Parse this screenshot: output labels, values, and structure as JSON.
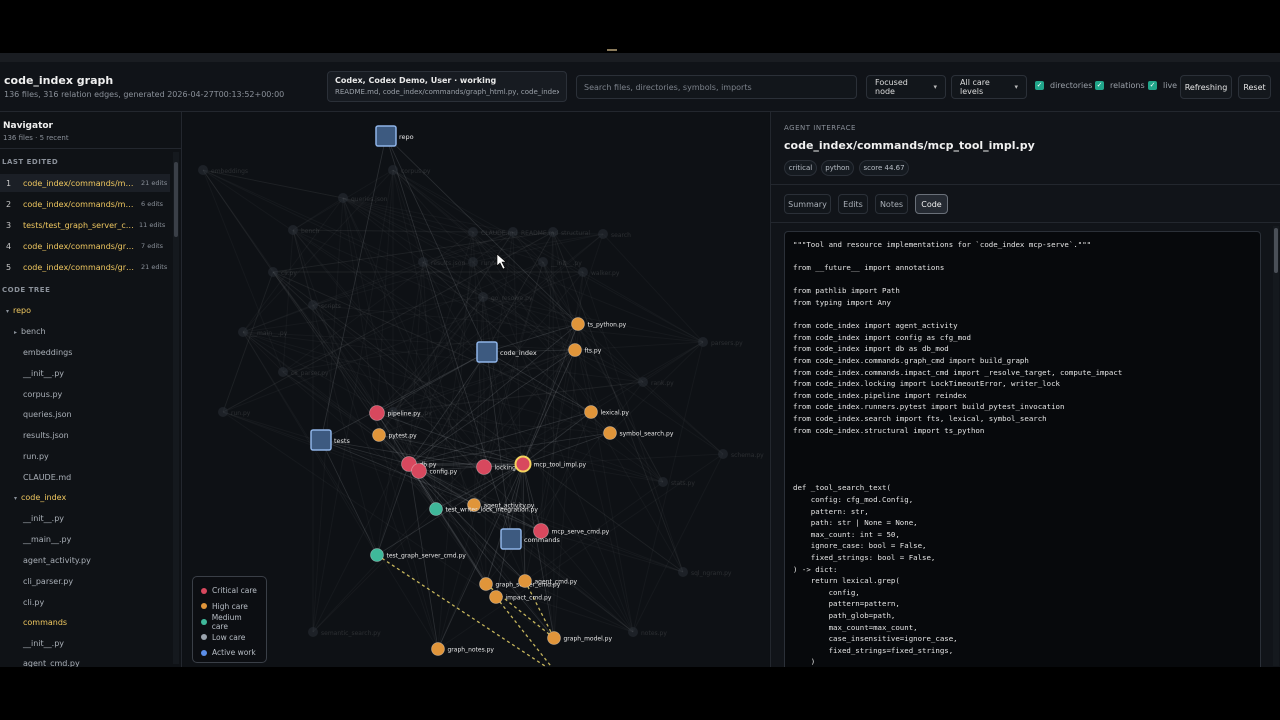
{
  "header": {
    "title": "code_index graph",
    "subtitle": "136 files, 316 relation edges, generated 2026-04-27T00:13:52+00:00",
    "activity_line1": "Codex, Codex Demo, User · working",
    "activity_line2": "README.md, code_index/commands/graph_html.py, code_index/co...",
    "search_placeholder": "Search files, directories, symbols, imports",
    "focus_select": "Focused node",
    "care_select": "All care levels",
    "checkboxes": [
      {
        "label": "directories"
      },
      {
        "label": "relations"
      },
      {
        "label": "live"
      }
    ],
    "refresh_label": "Refreshing",
    "reset_label": "Reset"
  },
  "navigator": {
    "title": "Navigator",
    "subtitle": "136 files · 5 recent",
    "last_edited_label": "LAST EDITED",
    "recent": [
      {
        "num": "1",
        "path": "code_index/commands/mcp_...",
        "edits": "21 edits"
      },
      {
        "num": "2",
        "path": "code_index/commands/mcp_s...",
        "edits": "6 edits"
      },
      {
        "num": "3",
        "path": "tests/test_graph_server_cmd.py",
        "edits": "11 edits"
      },
      {
        "num": "4",
        "path": "code_index/commands/graph...",
        "edits": "7 edits"
      },
      {
        "num": "5",
        "path": "code_index/commands/grap...",
        "edits": "21 edits"
      }
    ],
    "code_tree_label": "CODE TREE",
    "tree": [
      {
        "label": "repo"
      },
      {
        "label": "bench"
      },
      {
        "label": "embeddings"
      },
      {
        "label": "__init__.py"
      },
      {
        "label": "corpus.py"
      },
      {
        "label": "queries.json"
      },
      {
        "label": "results.json"
      },
      {
        "label": "run.py"
      },
      {
        "label": "CLAUDE.md"
      },
      {
        "label": "code_index"
      },
      {
        "label": "__init__.py"
      },
      {
        "label": "__main__.py"
      },
      {
        "label": "agent_activity.py"
      },
      {
        "label": "cli_parser.py"
      },
      {
        "label": "cli.py"
      },
      {
        "label": "commands"
      },
      {
        "label": "__init__.py"
      },
      {
        "label": "agent_cmd.py"
      }
    ]
  },
  "graph": {
    "colors": {
      "critical": "#d8485e",
      "high": "#e0953a",
      "medium": "#3fb89a",
      "low": "#9aa3ad",
      "active": "#5b8ee8",
      "dir_fill": "#3d5a80",
      "dir_stroke": "#8fb4e8"
    },
    "dir_nodes": [
      {
        "label": "repo"
      },
      {
        "label": "code_index"
      },
      {
        "label": "tests"
      },
      {
        "label": "commands"
      }
    ],
    "file_nodes": [
      {
        "label": "ts_python.py",
        "care": "high"
      },
      {
        "label": "fts.py",
        "care": "high"
      },
      {
        "label": "lexical.py",
        "care": "high"
      },
      {
        "label": "symbol_search.py",
        "care": "high"
      },
      {
        "label": "pipeline.py",
        "care": "critical"
      },
      {
        "label": "pytest.py",
        "care": "high"
      },
      {
        "label": "db.py",
        "care": "critical"
      },
      {
        "label": "config.py",
        "care": "critical"
      },
      {
        "label": "locking.py",
        "care": "critical"
      },
      {
        "label": "mcp_tool_impl.py",
        "care": "focus"
      },
      {
        "label": "agent_activity.py",
        "care": "high"
      },
      {
        "label": "test_writer_lock_integration.py",
        "care": "medium"
      },
      {
        "label": "mcp_serve_cmd.py",
        "care": "critical"
      },
      {
        "label": "test_graph_server_cmd.py",
        "care": "medium"
      },
      {
        "label": "graph_server_cmd.py",
        "care": "high"
      },
      {
        "label": "agent_cmd.py",
        "care": "high"
      },
      {
        "label": "impact_cmd.py",
        "care": "high"
      },
      {
        "label": "graph_model.py",
        "care": "high"
      },
      {
        "label": "graph_notes.py",
        "care": "high"
      }
    ],
    "faint_labels": [
      "embeddings",
      "bench",
      "queries.json",
      "cli.py",
      "scripts",
      "__init__.py",
      "__main__.py",
      "cli_parser.py",
      "run.py",
      "corpus.py",
      "results.json",
      "CLAUDE.md",
      "README.md",
      "structural",
      "search",
      "runners",
      "__init__.py",
      "go_resolve.py",
      "walker.py",
      "rank.py",
      "parsers.py",
      "schema.py",
      "stats.py",
      "sql_ngram.py",
      "notes.py",
      "semantic_search.py"
    ],
    "legend": [
      {
        "label": "Critical care",
        "color": "#d8485e"
      },
      {
        "label": "High care",
        "color": "#e0953a"
      },
      {
        "label": "Medium care",
        "color": "#3fb89a"
      },
      {
        "label": "Low care",
        "color": "#9aa3ad"
      },
      {
        "label": "Active work",
        "color": "#5b8ee8"
      }
    ]
  },
  "panel": {
    "kicker": "AGENT INTERFACE",
    "title": "code_index/commands/mcp_tool_impl.py",
    "tags": [
      "critical",
      "python",
      "score 44.67"
    ],
    "tabs": [
      "Summary",
      "Edits",
      "Notes",
      "Code"
    ],
    "active_tab": "Code",
    "code": "\"\"\"Tool and resource implementations for `code_index mcp-serve`.\"\"\"\n\nfrom __future__ import annotations\n\nfrom pathlib import Path\nfrom typing import Any\n\nfrom code_index import agent_activity\nfrom code_index import config as cfg_mod\nfrom code_index import db as db_mod\nfrom code_index.commands.graph_cmd import build_graph\nfrom code_index.commands.impact_cmd import _resolve_target, compute_impact\nfrom code_index.locking import LockTimeoutError, writer_lock\nfrom code_index.pipeline import reindex\nfrom code_index.runners.pytest import build_pytest_invocation\nfrom code_index.search import fts, lexical, symbol_search\nfrom code_index.structural import ts_python\n\n\n\n\ndef _tool_search_text(\n    config: cfg_mod.Config,\n    pattern: str,\n    path: str | None = None,\n    max_count: int = 50,\n    ignore_case: bool = False,\n    fixed_strings: bool = False,\n) -> dict:\n    return lexical.grep(\n        config,\n        pattern=pattern,\n        path_glob=path,\n        max_count=max_count,\n        case_insensitive=ignore_case,\n        fixed_strings=fixed_strings,\n    )"
  }
}
